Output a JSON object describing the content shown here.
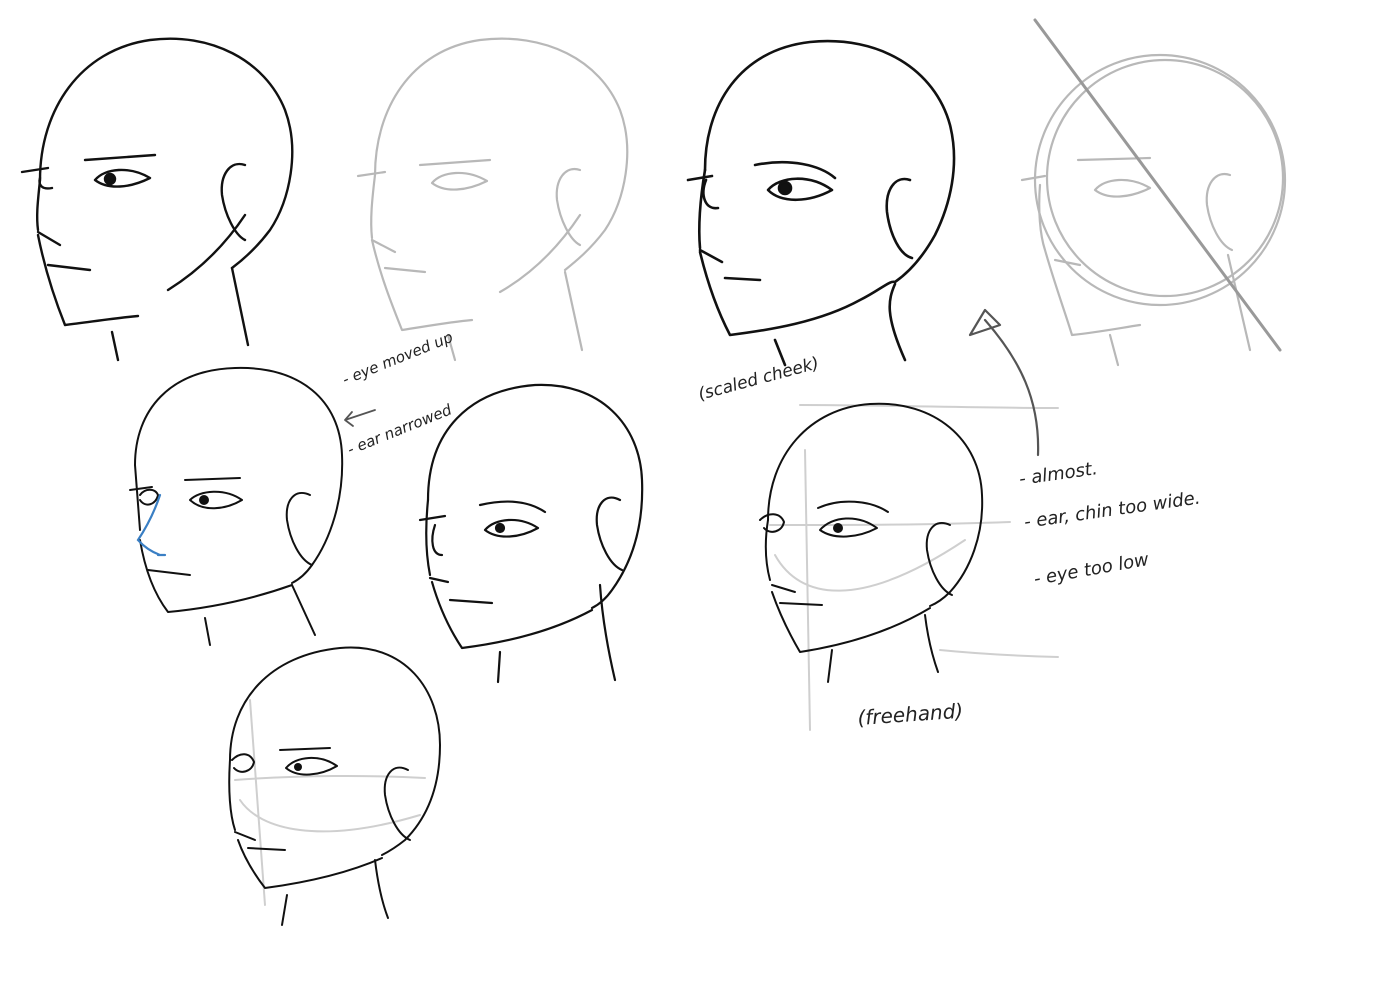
{
  "notes": {
    "eye_moved_up": "- eye moved up",
    "ear_narrowed": "- ear narrowed",
    "scaled_cheek": "(scaled cheek)",
    "almost": "- almost.",
    "ear_chin_too_wide": "- ear, chin too wide.",
    "eye_too_low": "- eye too low",
    "freehand": "(freehand)"
  },
  "colors": {
    "ink_dark": "#111111",
    "ink_mid": "#555555",
    "ink_light": "#b8b8b8",
    "guide": "#cfcfcf",
    "correction_blue": "#3a7fc4"
  }
}
